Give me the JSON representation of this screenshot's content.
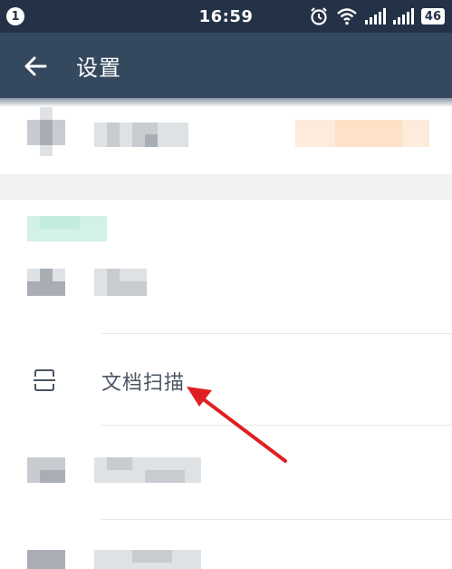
{
  "status_bar": {
    "notification_count": "1",
    "time": "16:59",
    "battery_level": "46",
    "icons": [
      "alarm-icon",
      "wifi-icon",
      "signal-icon",
      "signal-icon",
      "battery-icon"
    ]
  },
  "app_bar": {
    "title": "设置",
    "back_icon": "arrow-left-icon"
  },
  "menu": {
    "document_scan": {
      "label": "文档扫描",
      "icon": "scan-frame-icon"
    }
  },
  "annotation": {
    "arrow_color": "#e02020"
  },
  "colors": {
    "status_bar_bg": "#233246",
    "app_bar_bg": "#34495e",
    "text": "#4a5563",
    "accent_blurred": "#cdeee4",
    "orange_blurred": "#fde6cf"
  }
}
